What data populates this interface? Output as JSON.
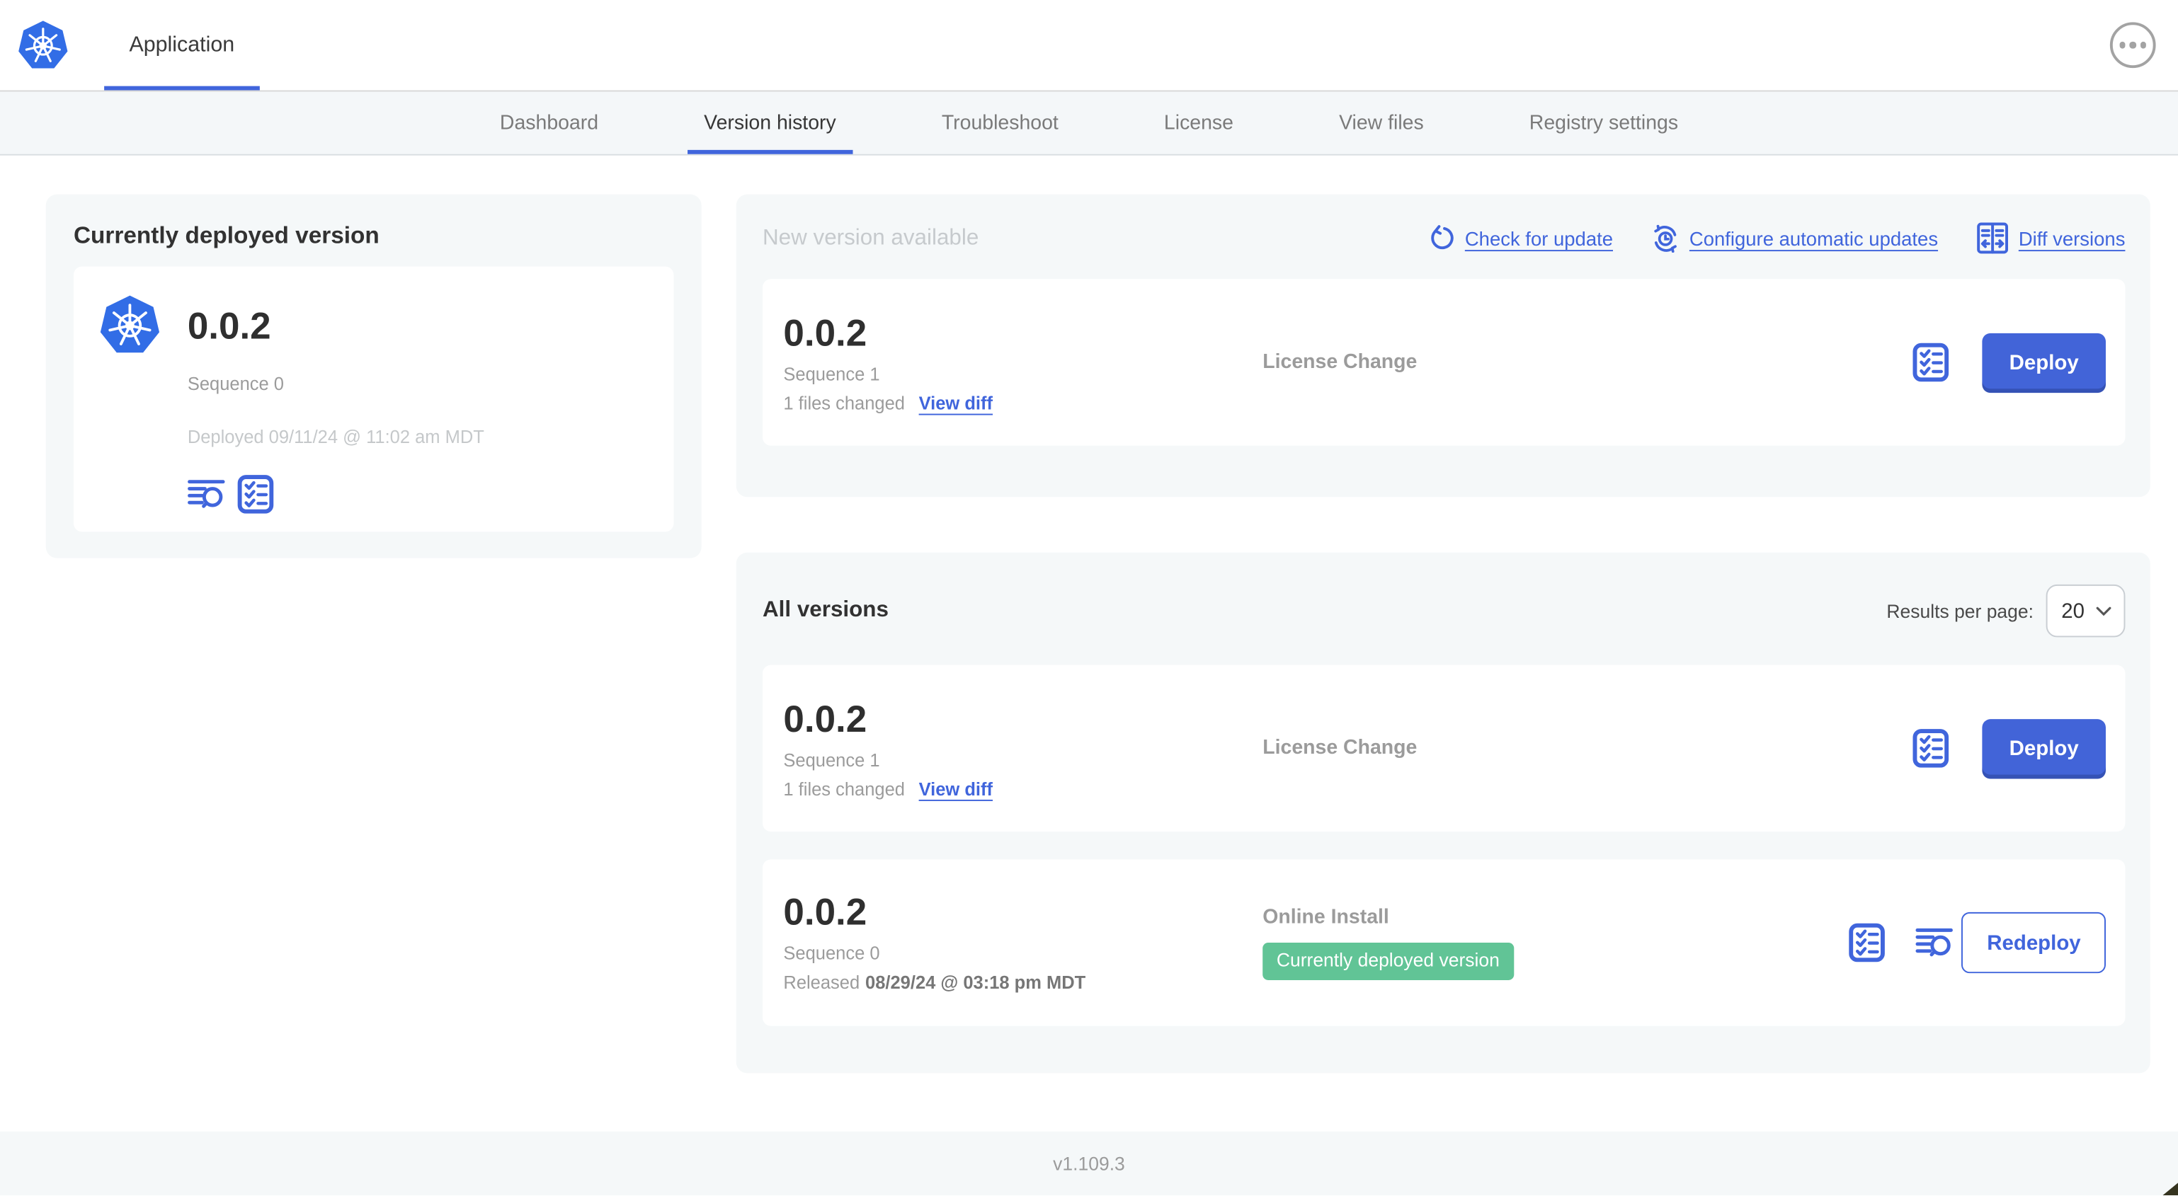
{
  "header": {
    "app_tab_label": "Application"
  },
  "nav": {
    "active_tab": "Version history",
    "tabs": [
      {
        "label": "Dashboard",
        "active": false
      },
      {
        "label": "Version history",
        "active": true
      },
      {
        "label": "Troubleshoot",
        "active": false
      },
      {
        "label": "License",
        "active": false
      },
      {
        "label": "View files",
        "active": false
      },
      {
        "label": "Registry settings",
        "active": false
      }
    ]
  },
  "currently_deployed": {
    "title": "Currently deployed version",
    "version": "0.0.2",
    "sequence": "Sequence 0",
    "deployed": "Deployed 09/11/24 @ 11:02 am MDT"
  },
  "new_version": {
    "title": "New version available",
    "check_for_update": "Check for update",
    "configure_auto_updates": "Configure automatic updates",
    "diff_versions": "Diff versions",
    "card": {
      "version": "0.0.2",
      "sequence": "Sequence 1",
      "files_changed": "1 files changed",
      "view_diff": "View diff",
      "source": "License Change",
      "action": "Deploy"
    }
  },
  "all_versions": {
    "title": "All versions",
    "results_per_page_label": "Results per page:",
    "results_per_page": "20",
    "rows": [
      {
        "version": "0.0.2",
        "sequence": "Sequence 1",
        "files_changed": "1 files changed",
        "view_diff": "View diff",
        "source": "License Change",
        "action": "Deploy"
      },
      {
        "version": "0.0.2",
        "sequence": "Sequence 0",
        "released_prefix": "Released",
        "released_date": "08/29/24 @ 03:18 pm MDT",
        "source": "Online Install",
        "badge": "Currently deployed version",
        "action": "Redeploy"
      }
    ]
  },
  "footer": {
    "app_version": "v1.109.3"
  },
  "colors": {
    "accent_blue": "#4065dc",
    "button_blue": "#4264d8",
    "badge_green": "#61c496",
    "panel_gray": "#f5f8f9",
    "k8s_logo_blue": "#326de6"
  }
}
